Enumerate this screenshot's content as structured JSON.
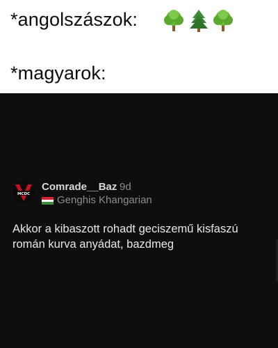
{
  "meme": {
    "caption_top": "*angolszászok:",
    "caption_bottom": "*magyarok:",
    "emojis": [
      "deciduous-tree-icon",
      "evergreen-tree-icon",
      "deciduous-tree-icon"
    ]
  },
  "comment": {
    "username": "Comrade__Baz",
    "time": "9d",
    "avatar_text": "MCDC",
    "flair": "Genghis Khangarian",
    "flag": [
      "#d12630",
      "#ffffff",
      "#3f8c3a"
    ],
    "body": "Akkor a kibaszott rohadt geciszemű kisfaszú román kurva anyádat, bazdmeg"
  },
  "colors": {
    "background_top": "#ffffff",
    "background_dark": "#0f0e0f",
    "username": "#d8d8d8",
    "muted": "#8c8c8c",
    "body": "#e8e8e8",
    "avatar_accent": "#c8101e"
  }
}
